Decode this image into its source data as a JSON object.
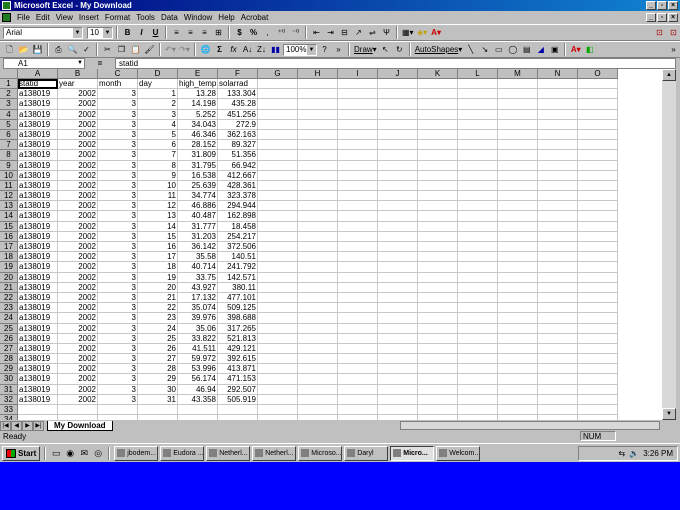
{
  "window": {
    "title": "Microsoft Excel - My Download"
  },
  "menu": [
    "File",
    "Edit",
    "View",
    "Insert",
    "Format",
    "Tools",
    "Data",
    "Window",
    "Help",
    "Acrobat"
  ],
  "format_toolbar": {
    "font": "Arial",
    "size": "10",
    "bold": "B",
    "italic": "I",
    "underline": "U",
    "currency": "$",
    "percent": "%"
  },
  "std_toolbar": {
    "zoom": "100%",
    "draw_label": "Draw",
    "autoshapes_label": "AutoShapes"
  },
  "formula_bar": {
    "cell_ref": "A1",
    "equals": "=",
    "content": "statid"
  },
  "columns": [
    "A",
    "B",
    "C",
    "D",
    "E",
    "F",
    "G",
    "H",
    "I",
    "J",
    "K",
    "L",
    "M",
    "N",
    "O"
  ],
  "sheet": {
    "headers": [
      "statid",
      "year",
      "month",
      "day",
      "high_temp",
      "solarrad"
    ],
    "rows": [
      [
        "a138019",
        "2002",
        "3",
        "1",
        "13.28",
        "133.304"
      ],
      [
        "a138019",
        "2002",
        "3",
        "2",
        "14.198",
        "435.28"
      ],
      [
        "a138019",
        "2002",
        "3",
        "3",
        "5.252",
        "451.256"
      ],
      [
        "a138019",
        "2002",
        "3",
        "4",
        "34.043",
        "272.9"
      ],
      [
        "a138019",
        "2002",
        "3",
        "5",
        "46.346",
        "362.163"
      ],
      [
        "a138019",
        "2002",
        "3",
        "6",
        "28.152",
        "89.327"
      ],
      [
        "a138019",
        "2002",
        "3",
        "7",
        "31.809",
        "51.356"
      ],
      [
        "a138019",
        "2002",
        "3",
        "8",
        "31.795",
        "66.942"
      ],
      [
        "a138019",
        "2002",
        "3",
        "9",
        "16.538",
        "412.667"
      ],
      [
        "a138019",
        "2002",
        "3",
        "10",
        "25.639",
        "428.361"
      ],
      [
        "a138019",
        "2002",
        "3",
        "11",
        "34.774",
        "323.378"
      ],
      [
        "a138019",
        "2002",
        "3",
        "12",
        "46.886",
        "294.944"
      ],
      [
        "a138019",
        "2002",
        "3",
        "13",
        "40.487",
        "162.898"
      ],
      [
        "a138019",
        "2002",
        "3",
        "14",
        "31.777",
        "18.458"
      ],
      [
        "a138019",
        "2002",
        "3",
        "15",
        "31.203",
        "254.217"
      ],
      [
        "a138019",
        "2002",
        "3",
        "16",
        "36.142",
        "372.506"
      ],
      [
        "a138019",
        "2002",
        "3",
        "17",
        "35.58",
        "140.51"
      ],
      [
        "a138019",
        "2002",
        "3",
        "18",
        "40.714",
        "241.792"
      ],
      [
        "a138019",
        "2002",
        "3",
        "19",
        "33.75",
        "142.571"
      ],
      [
        "a138019",
        "2002",
        "3",
        "20",
        "43.927",
        "380.11"
      ],
      [
        "a138019",
        "2002",
        "3",
        "21",
        "17.132",
        "477.101"
      ],
      [
        "a138019",
        "2002",
        "3",
        "22",
        "35.074",
        "509.125"
      ],
      [
        "a138019",
        "2002",
        "3",
        "23",
        "39.976",
        "398.688"
      ],
      [
        "a138019",
        "2002",
        "3",
        "24",
        "35.06",
        "317.265"
      ],
      [
        "a138019",
        "2002",
        "3",
        "25",
        "33.822",
        "521.813"
      ],
      [
        "a138019",
        "2002",
        "3",
        "26",
        "41.511",
        "429.121"
      ],
      [
        "a138019",
        "2002",
        "3",
        "27",
        "59.972",
        "392.615"
      ],
      [
        "a138019",
        "2002",
        "3",
        "28",
        "53.996",
        "413.871"
      ],
      [
        "a138019",
        "2002",
        "3",
        "29",
        "56.174",
        "471.153"
      ],
      [
        "a138019",
        "2002",
        "3",
        "30",
        "46.94",
        "292.507"
      ],
      [
        "a138019",
        "2002",
        "3",
        "31",
        "43.358",
        "505.919"
      ]
    ],
    "row_numbers": [
      "1",
      "2",
      "3",
      "4",
      "5",
      "6",
      "7",
      "8",
      "9",
      "10",
      "11",
      "12",
      "13",
      "14",
      "15",
      "16",
      "17",
      "18",
      "19",
      "20",
      "21",
      "22",
      "23",
      "24",
      "25",
      "26",
      "27",
      "28",
      "29",
      "30",
      "31",
      "32",
      "33",
      "34"
    ]
  },
  "sheet_tab": "My Download",
  "status": {
    "text": "Ready",
    "num": "NUM"
  },
  "taskbar": {
    "start": "Start",
    "tasks": [
      "jbodem...",
      "Eudora ...",
      "Netherl...",
      "Netherl...",
      "Microso...",
      "Daryl",
      "Micro...",
      "Welcom..."
    ],
    "active_index": 6,
    "clock": "3:26 PM"
  },
  "colors": {
    "titlebar": "#000080",
    "desktop": "#0000ff",
    "chrome": "#c0c0c0"
  }
}
